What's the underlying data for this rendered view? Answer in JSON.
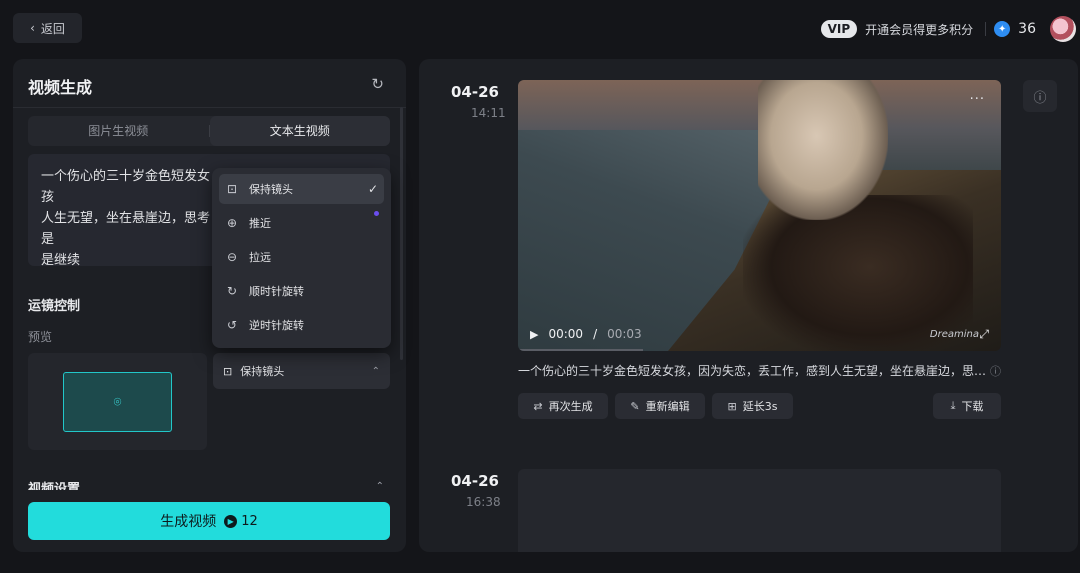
{
  "topbar": {
    "back_label": "返回",
    "vip_badge": "VIP",
    "vip_text": "开通会员得更多积分",
    "points": "36"
  },
  "left": {
    "title": "视频生成",
    "tabs": [
      {
        "label": "图片生视频",
        "active": false
      },
      {
        "label": "文本生视频",
        "active": true
      }
    ],
    "prompt_lines": [
      "一个伤心的三十岁金色短发女孩",
      "人生无望，坐在悬崖边，思考是",
      "是继续"
    ],
    "camera_section": "运镜控制",
    "preview_label": "预览",
    "camera_selected": "保持镜头",
    "settings_title": "视频设置",
    "generate_label": "生成视频",
    "generate_cost": "12",
    "accent_color": "#22dcdc"
  },
  "dropdown": {
    "items": [
      {
        "label": "保持镜头",
        "icon": "focus-frame-icon",
        "selected": true
      },
      {
        "label": "推近",
        "icon": "zoom-in-icon",
        "selected": false
      },
      {
        "label": "拉远",
        "icon": "zoom-out-icon",
        "selected": false
      },
      {
        "label": "顺时针旋转",
        "icon": "rotate-clockwise-icon",
        "selected": false
      },
      {
        "label": "逆时针旋转",
        "icon": "rotate-counterclockwise-icon",
        "selected": false
      }
    ]
  },
  "results": [
    {
      "date": "04-26",
      "time": "14:11",
      "video": {
        "current_time": "00:00",
        "separator": "/",
        "duration": "00:03",
        "watermark": "Dreamina"
      },
      "caption": "一个伤心的三十岁金色短发女孩，因为失恋，丢工作，感到人生无望，坐在悬崖边，思…",
      "actions": {
        "regenerate": "再次生成",
        "reedit": "重新编辑",
        "extend": "延长3s",
        "download": "下载"
      }
    },
    {
      "date": "04-26",
      "time": "16:38"
    }
  ]
}
